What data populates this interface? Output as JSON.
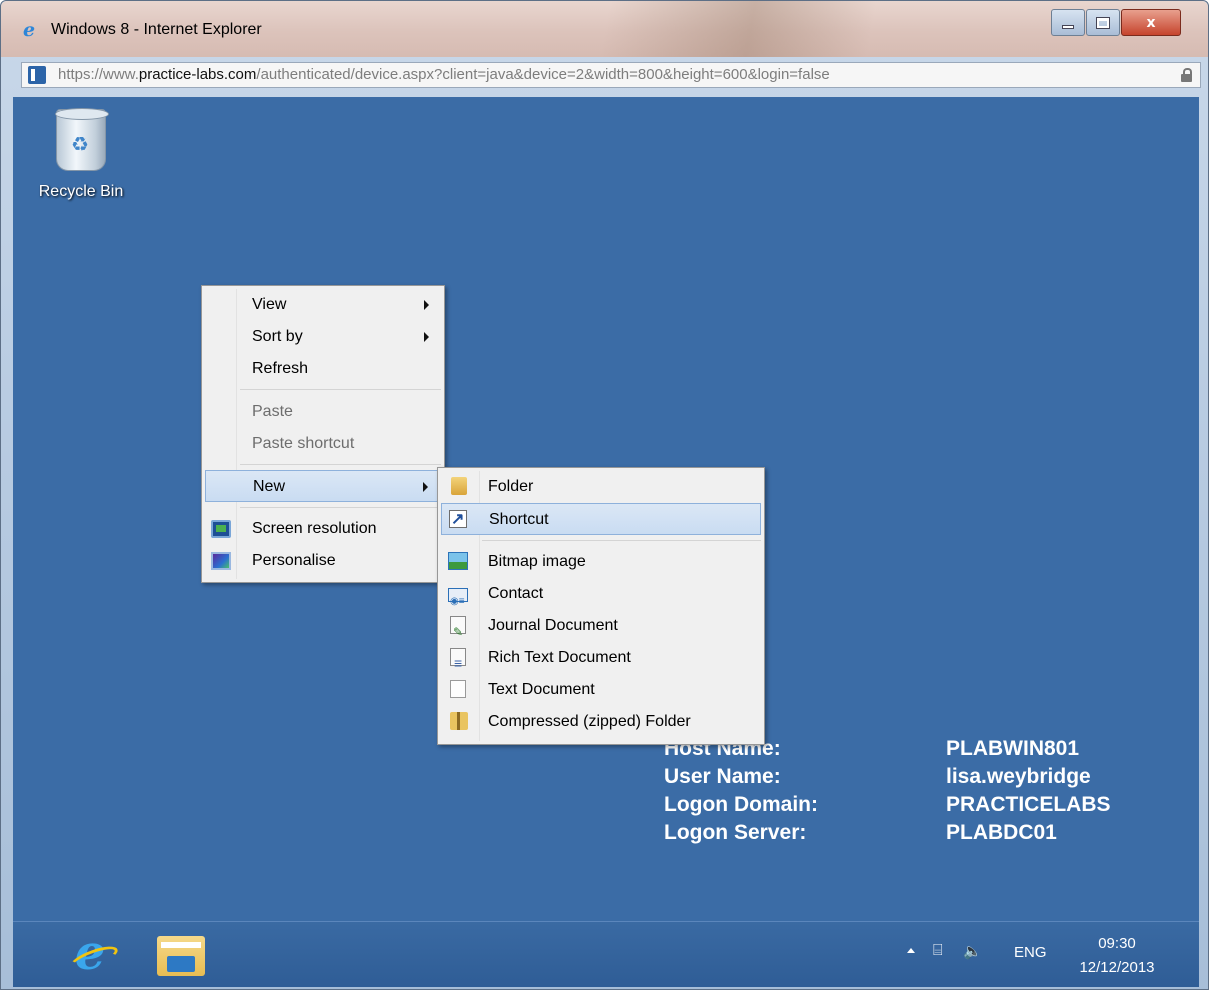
{
  "browser": {
    "title": "Windows 8 - Internet Explorer",
    "url_prefix": "https://www.",
    "url_domain": "practice-labs.com",
    "url_path": "/authenticated/device.aspx?client=java&device=2&width=800&height=600&login=false",
    "controls": {
      "minimize": "minimize",
      "maximize": "maximize",
      "close": "x"
    }
  },
  "desktop": {
    "background_color": "#3b6ca6",
    "icons": [
      {
        "label": "Recycle Bin",
        "icon": "recycle-bin-icon"
      }
    ]
  },
  "context_menu": {
    "items": [
      {
        "label": "View",
        "submenu": true
      },
      {
        "label": "Sort by",
        "submenu": true
      },
      {
        "label": "Refresh"
      },
      {
        "label": "Paste",
        "disabled": true
      },
      {
        "label": "Paste shortcut",
        "disabled": true
      },
      {
        "label": "New",
        "submenu": true,
        "highlighted": true
      },
      {
        "label": "Screen resolution",
        "icon": "monitor-icon"
      },
      {
        "label": "Personalise",
        "icon": "personalise-icon"
      }
    ]
  },
  "new_submenu": {
    "items": [
      {
        "label": "Folder",
        "icon": "folder-icon"
      },
      {
        "label": "Shortcut",
        "icon": "shortcut-icon",
        "highlighted": true
      },
      {
        "label": "Bitmap image",
        "icon": "bitmap-icon"
      },
      {
        "label": "Contact",
        "icon": "contact-icon"
      },
      {
        "label": "Journal Document",
        "icon": "journal-icon"
      },
      {
        "label": "Rich Text Document",
        "icon": "rich-text-icon"
      },
      {
        "label": "Text Document",
        "icon": "text-document-icon"
      },
      {
        "label": "Compressed (zipped) Folder",
        "icon": "zip-folder-icon"
      }
    ]
  },
  "bginfo": [
    {
      "key": "Host Name:",
      "value": "PLABWIN801"
    },
    {
      "key": "User Name:",
      "value": "lisa.weybridge"
    },
    {
      "key": "Logon Domain:",
      "value": "PRACTICELABS"
    },
    {
      "key": "Logon Server:",
      "value": "PLABDC01"
    }
  ],
  "taskbar": {
    "pinned": [
      "internet-explorer-icon",
      "file-explorer-icon"
    ],
    "tray": {
      "language": "ENG",
      "time": "09:30",
      "date": "12/12/2013"
    }
  }
}
